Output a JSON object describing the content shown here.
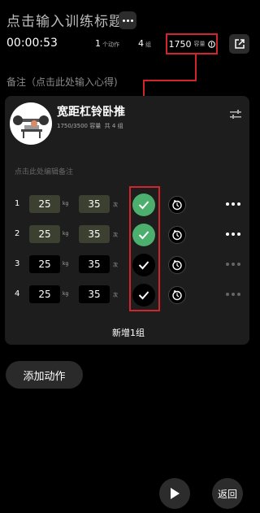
{
  "header": {
    "title": "点击输入训练标题",
    "more_icon": "more-horizontal-icon"
  },
  "stats": {
    "timer": "00:00:53",
    "actions_count": "1",
    "actions_unit": "个动作",
    "sets_count": "4",
    "sets_unit": "组",
    "volume_value": "1750",
    "volume_unit": "容量",
    "info_icon": "info-icon",
    "share_icon": "share-external-icon"
  },
  "note_placeholder": "备注（点击此处输入心得)",
  "exercise": {
    "name": "宽距杠铃卧推",
    "volume_progress": "1750/3500 容量",
    "sets_summary": "共 4 组",
    "edit_note_placeholder": "点击此处编辑备注",
    "swap_icon": "swap-settings-icon",
    "sets": [
      {
        "num": "1",
        "weight": "25",
        "weight_unit": "kg",
        "reps": "35",
        "reps_unit": "次",
        "done": true
      },
      {
        "num": "2",
        "weight": "25",
        "weight_unit": "kg",
        "reps": "35",
        "reps_unit": "次",
        "done": true
      },
      {
        "num": "3",
        "weight": "25",
        "weight_unit": "kg",
        "reps": "35",
        "reps_unit": "次",
        "done": false
      },
      {
        "num": "4",
        "weight": "25",
        "weight_unit": "kg",
        "reps": "35",
        "reps_unit": "次",
        "done": false
      }
    ],
    "add_set_label": "新增1组"
  },
  "add_action_label": "添加动作",
  "footer": {
    "play_icon": "play-icon",
    "back_label": "返回"
  },
  "colors": {
    "done": "#4caf6d",
    "highlight": "#d0262b",
    "card": "#1d1d1d"
  }
}
